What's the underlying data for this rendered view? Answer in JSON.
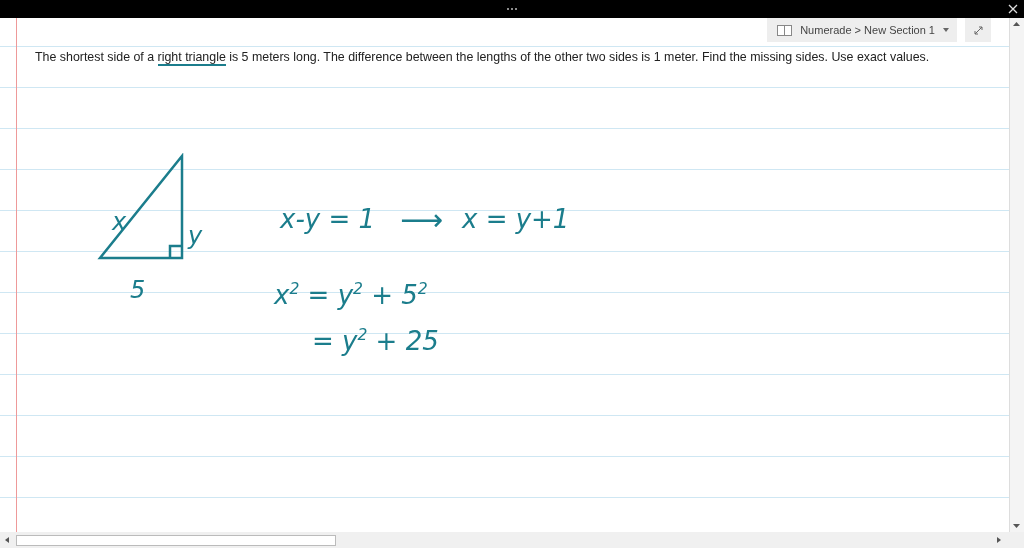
{
  "breadcrumb": {
    "label": "Numerade > New Section 1"
  },
  "question": [
    {
      "text": "The shortest side of a ",
      "underlined": false
    },
    {
      "text": "right triangle",
      "underlined": true
    },
    {
      "text": " is 5 meters long. The difference between the lengths of the other two sides is 1 meter. Find the missing sides. Use exact values.",
      "underlined": false
    }
  ],
  "ink": [
    {
      "kind": "label",
      "text": "x"
    },
    {
      "kind": "label",
      "text": "y"
    },
    {
      "kind": "label",
      "text": "5"
    },
    {
      "kind": "equation",
      "text": "x-y = 1"
    },
    {
      "kind": "arrow",
      "text": "⟶"
    },
    {
      "kind": "equation",
      "text": "x = y+1"
    },
    {
      "kind": "equation",
      "text": "x$^{2}$ = y$^{2}$ + 5$^{2}$"
    },
    {
      "kind": "equation",
      "text": "= y$^{2}$ + 25"
    }
  ]
}
